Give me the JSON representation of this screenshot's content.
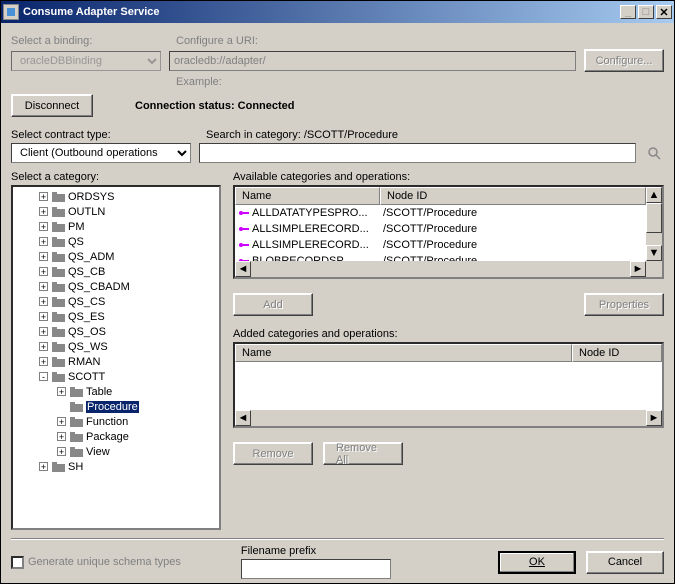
{
  "window": {
    "title": "Consume Adapter Service"
  },
  "labels": {
    "select_binding": "Select a binding:",
    "configure_uri": "Configure a URI:",
    "example": "Example:",
    "disconnect": "Disconnect",
    "configure": "Configure...",
    "connection_status": "Connection status: Connected",
    "select_contract_type": "Select contract type:",
    "search_in_category": "Search in category: /SCOTT/Procedure",
    "select_category": "Select a category:",
    "available": "Available categories and operations:",
    "added": "Added categories and operations:",
    "add": "Add",
    "properties": "Properties",
    "remove": "Remove",
    "remove_all": "Remove All",
    "generate_unique": "Generate unique schema types",
    "filename_prefix": "Filename prefix",
    "ok": "OK",
    "cancel": "Cancel"
  },
  "binding": {
    "value": "oracleDBBinding"
  },
  "uri": {
    "value": "oracledb://adapter/"
  },
  "contract": {
    "value": "Client (Outbound operations"
  },
  "search": {
    "value": ""
  },
  "filename_prefix_value": "",
  "columns": {
    "name": "Name",
    "node_id": "Node ID"
  },
  "tree": [
    {
      "label": "ORDSYS",
      "depth": 1,
      "expander": "+"
    },
    {
      "label": "OUTLN",
      "depth": 1,
      "expander": "+"
    },
    {
      "label": "PM",
      "depth": 1,
      "expander": "+"
    },
    {
      "label": "QS",
      "depth": 1,
      "expander": "+"
    },
    {
      "label": "QS_ADM",
      "depth": 1,
      "expander": "+"
    },
    {
      "label": "QS_CB",
      "depth": 1,
      "expander": "+"
    },
    {
      "label": "QS_CBADM",
      "depth": 1,
      "expander": "+"
    },
    {
      "label": "QS_CS",
      "depth": 1,
      "expander": "+"
    },
    {
      "label": "QS_ES",
      "depth": 1,
      "expander": "+"
    },
    {
      "label": "QS_OS",
      "depth": 1,
      "expander": "+"
    },
    {
      "label": "QS_WS",
      "depth": 1,
      "expander": "+"
    },
    {
      "label": "RMAN",
      "depth": 1,
      "expander": "+"
    },
    {
      "label": "SCOTT",
      "depth": 1,
      "expander": "-"
    },
    {
      "label": "Table",
      "depth": 2,
      "expander": "+"
    },
    {
      "label": "Procedure",
      "depth": 2,
      "expander": "",
      "selected": true
    },
    {
      "label": "Function",
      "depth": 2,
      "expander": "+"
    },
    {
      "label": "Package",
      "depth": 2,
      "expander": "+"
    },
    {
      "label": "View",
      "depth": 2,
      "expander": "+"
    },
    {
      "label": "SH",
      "depth": 1,
      "expander": "+"
    }
  ],
  "operations": [
    {
      "name": "ALLDATATYPESPRO...",
      "node_id": "/SCOTT/Procedure"
    },
    {
      "name": "ALLSIMPLERECORD...",
      "node_id": "/SCOTT/Procedure"
    },
    {
      "name": "ALLSIMPLERECORD...",
      "node_id": "/SCOTT/Procedure"
    },
    {
      "name": "BLOBRECORDSP",
      "node_id": "/SCOTT/Procedure"
    }
  ]
}
